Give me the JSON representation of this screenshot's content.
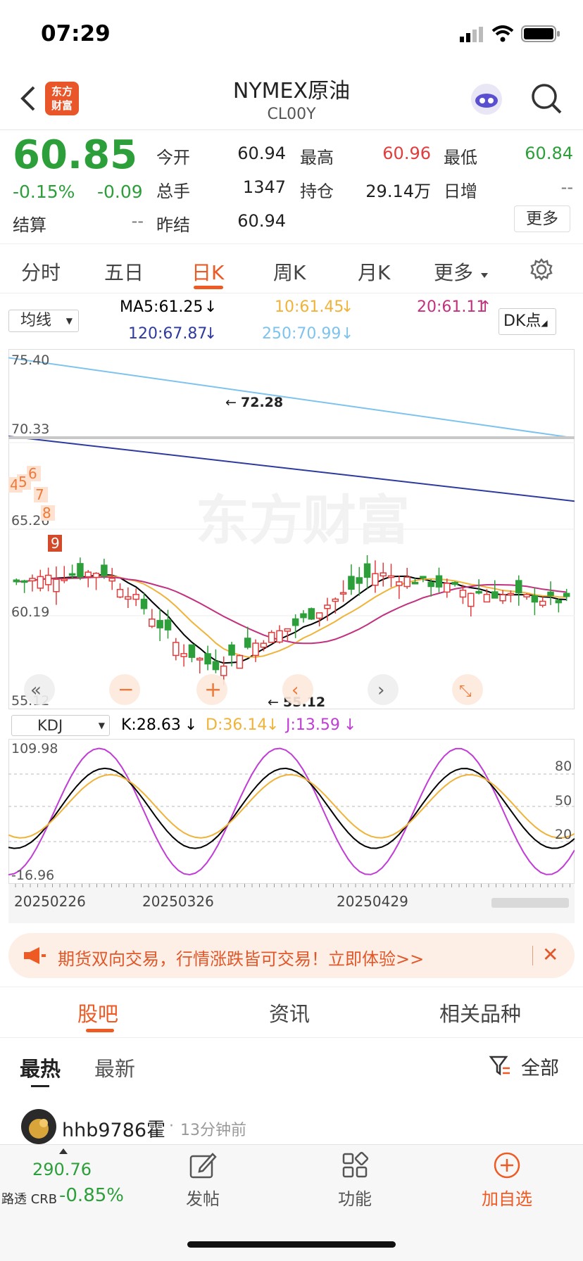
{
  "status_bar": {
    "time": "07:29"
  },
  "header": {
    "title": "NYMEX原油",
    "code": "CL00Y",
    "logo": "东方财富",
    "logo_line1": "东方",
    "logo_line2": "财富"
  },
  "quote": {
    "price": "60.85",
    "change_pct": "-0.15%",
    "change": "-0.09",
    "open_label": "今开",
    "open": "60.94",
    "high_label": "最高",
    "high": "60.96",
    "low_label": "最低",
    "low": "60.84",
    "volume_label": "总手",
    "volume": "1347",
    "oi_label": "持仓",
    "oi": "29.14万",
    "daily_inc_label": "日增",
    "daily_inc": "--",
    "settle_label": "结算",
    "settle": "--",
    "prev_settle_label": "昨结",
    "prev_settle": "60.94",
    "more_button": "更多"
  },
  "tabs": [
    "分时",
    "五日",
    "日K",
    "周K",
    "月K",
    "更多"
  ],
  "active_tab": "日K",
  "ma_bar": {
    "selector": "均线",
    "ma5": "MA5:61.25",
    "ma10": "10:61.45",
    "ma20": "20:61.11",
    "ma120": "120:67.87",
    "ma250": "250:70.99",
    "dk_button": "DK点"
  },
  "chart_data": {
    "type": "candlestick",
    "y_ticks": [
      "75.40",
      "70.33",
      "65.26",
      "60.19",
      "55.12"
    ],
    "max_label": "72.28",
    "min_label": "55.12",
    "x_labels": [
      "20250226",
      "20250326",
      "20250429"
    ],
    "signal_numbers": [
      "4",
      "5",
      "6",
      "7",
      "8",
      "9"
    ],
    "watermark": "东方财富"
  },
  "kdj": {
    "selector": "KDJ",
    "k": "K:28.63",
    "d": "D:36.14",
    "j": "J:13.59",
    "y_top": "109.98",
    "y_bottom": "-16.96",
    "levels": [
      "80",
      "50",
      "20"
    ]
  },
  "banner": {
    "text": "期货双向交易，行情涨跌皆可交易！立即体验>>"
  },
  "section_tabs": [
    "股吧",
    "资讯",
    "相关品种"
  ],
  "active_section": "股吧",
  "filter_tabs": {
    "hot": "最热",
    "new": "最新",
    "all": "全部"
  },
  "post": {
    "user": "hhb9786霍",
    "time": "13分钟前",
    "dot": "·"
  },
  "bottom": {
    "index_value": "290.76",
    "index_name": "路透 CRB",
    "index_change": "-0.85%",
    "post": "发帖",
    "func": "功能",
    "add": "加自选"
  },
  "colors": {
    "up": "#e23d3d",
    "down": "#2c9f3a",
    "accent": "#ee5a24",
    "ma250": "#7ec3ee",
    "ma120": "#2e3a9e",
    "ma20": "#c2317f",
    "ma10": "#f0b33a"
  }
}
